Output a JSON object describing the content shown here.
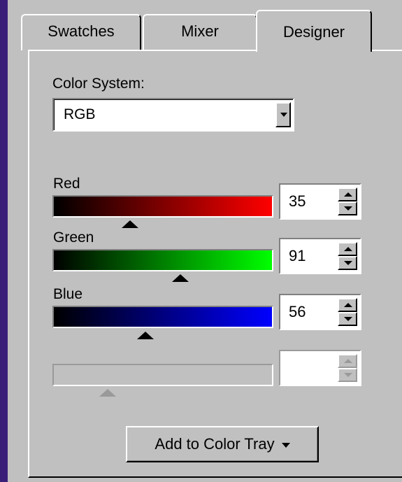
{
  "tabs": [
    {
      "label": "Swatches"
    },
    {
      "label": "Mixer"
    },
    {
      "label": "Designer"
    }
  ],
  "active_tab": "Designer",
  "color_system": {
    "label": "Color System:",
    "value": "RGB"
  },
  "channels": [
    {
      "label": "Red",
      "value": "35",
      "level": 0.35,
      "color": "#ff0000"
    },
    {
      "label": "Green",
      "value": "91",
      "level": 0.58,
      "color": "#00ff00"
    },
    {
      "label": "Blue",
      "value": "56",
      "level": 0.42,
      "color": "#0000ff"
    },
    {
      "label": "",
      "value": "",
      "level": 0.25,
      "disabled": true
    }
  ],
  "add_button": {
    "label": "Add to Color Tray",
    "icon": "chevron-down-icon"
  }
}
